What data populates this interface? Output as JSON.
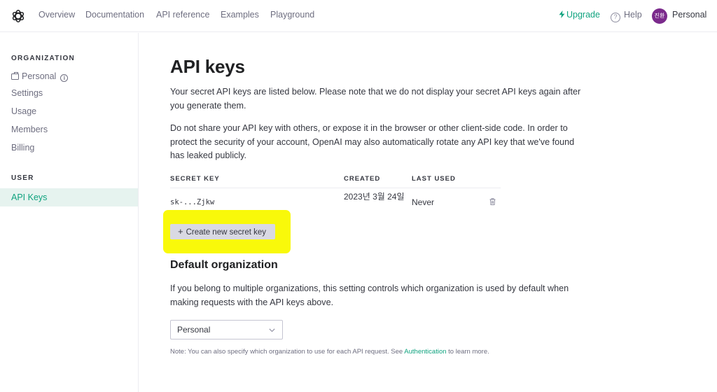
{
  "nav": {
    "links": [
      "Overview",
      "Documentation",
      "API reference",
      "Examples",
      "Playground"
    ],
    "upgrade": "Upgrade",
    "help": "Help",
    "avatar_initials": "진환",
    "account": "Personal",
    "accent_color": "#10a37f",
    "avatar_color": "#7b2a8c"
  },
  "sidebar": {
    "org_heading": "ORGANIZATION",
    "org_name": "Personal",
    "org_items": [
      "Settings",
      "Usage",
      "Members",
      "Billing"
    ],
    "user_heading": "USER",
    "user_items": [
      "API Keys"
    ]
  },
  "main": {
    "title": "API keys",
    "intro": "Your secret API keys are listed below. Please note that we do not display your secret API keys again after you generate them.",
    "warning": "Do not share your API key with others, or expose it in the browser or other client-side code. In order to protect the security of your account, OpenAI may also automatically rotate any API key that we've found has leaked publicly.",
    "table": {
      "headers": [
        "SECRET KEY",
        "CREATED",
        "LAST USED"
      ],
      "rows": [
        {
          "key": "sk-...Zjkw",
          "created": "2023년 3월 24일",
          "last_used": "Never"
        }
      ]
    },
    "create_button": "Create new secret key",
    "default_org_title": "Default organization",
    "default_org_desc": "If you belong to multiple organizations, this setting controls which organization is used by default when making requests with the API keys above.",
    "default_org_selected": "Personal",
    "note_prefix": "Note: You can also specify which organization to use for each API request. See ",
    "note_link": "Authentication",
    "note_suffix": " to learn more.",
    "highlight_color": "#f9f90a"
  }
}
